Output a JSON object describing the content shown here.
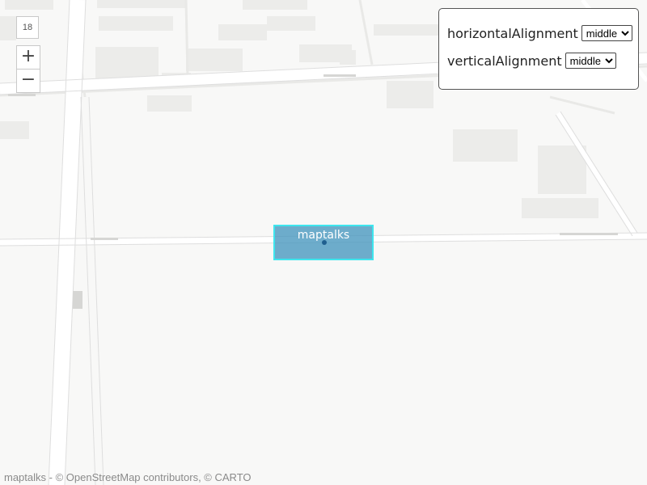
{
  "map": {
    "zoom_level": "18",
    "zoom_in_symbol": "+",
    "zoom_out_symbol": "−",
    "marker": {
      "label": "maptalks",
      "box_fill": "#4696be",
      "box_stroke": "#3ee6ee",
      "anchor_color": "#1f5f8f"
    }
  },
  "panel": {
    "horizontal": {
      "label": "horizontalAlignment",
      "selected": "middle"
    },
    "vertical": {
      "label": "verticalAlignment",
      "selected": "middle"
    }
  },
  "attribution": {
    "text": "maptalks - © OpenStreetMap contributors, © CARTO"
  }
}
